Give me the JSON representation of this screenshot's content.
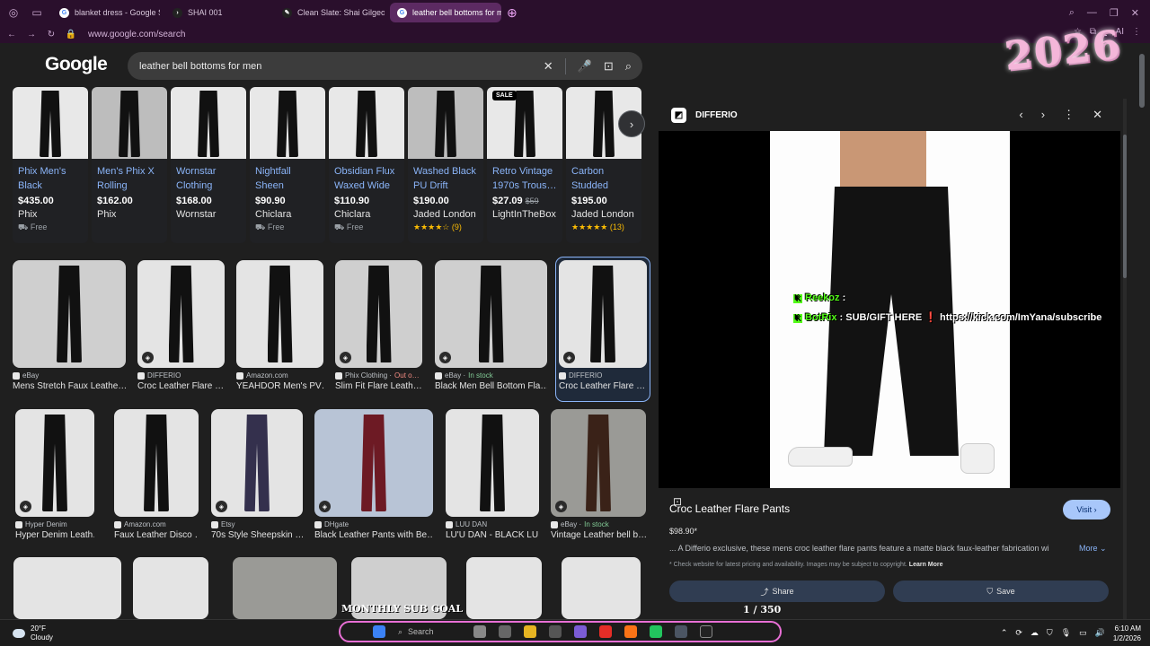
{
  "browser": {
    "tabs": [
      {
        "label": "blanket dress - Google Se",
        "active": false
      },
      {
        "label": "SHAI 001",
        "active": false
      },
      {
        "label": "Clean Slate: Shai Gilgeous",
        "active": false
      },
      {
        "label": "leather bell bottoms for me",
        "active": true
      }
    ],
    "url": "www.google.com/search"
  },
  "google": {
    "logo": "Google",
    "query": "leather bell bottoms for men"
  },
  "overlay_year": "2026",
  "shopping": [
    {
      "title": "Phix Men's Black Leathe…",
      "price": "$435.00",
      "old_price": "",
      "seller": "Phix",
      "extra": "Free",
      "sale": false
    },
    {
      "title": "Men's Phix X Rolling Stone…",
      "price": "$162.00",
      "old_price": "",
      "seller": "Phix",
      "extra": "",
      "sale": false
    },
    {
      "title": "Wornstar Clothing Cutl…",
      "price": "$168.00",
      "old_price": "",
      "seller": "Wornstar",
      "extra": "",
      "sale": false
    },
    {
      "title": "Nightfall Sheen Flared…",
      "price": "$90.90",
      "old_price": "",
      "seller": "Chiclara",
      "extra": "Free",
      "sale": false
    },
    {
      "title": "Obsidian Flux Waxed Wide …",
      "price": "$110.90",
      "old_price": "",
      "seller": "Chiclara",
      "extra": "Free",
      "sale": false
    },
    {
      "title": "Washed Black PU Drift Jean…",
      "price": "$190.00",
      "old_price": "",
      "seller": "Jaded London",
      "extra": "★★★★☆ (9)",
      "sale": false
    },
    {
      "title": "Retro Vintage 1970s Trous…",
      "price": "$27.09",
      "old_price": "$59",
      "seller": "LightInTheBox",
      "extra": "",
      "sale": true
    },
    {
      "title": "Carbon Studded Drift…",
      "price": "$195.00",
      "old_price": "",
      "seller": "Jaded London",
      "extra": "★★★★★ (13)",
      "sale": false
    }
  ],
  "sale_label": "SALE",
  "images_row1": [
    {
      "source": "eBay",
      "stock": "",
      "title": "Mens Stretch Faux Leathe…"
    },
    {
      "source": "DIFFERIO",
      "stock": "",
      "title": "Croc Leather Flare …"
    },
    {
      "source": "Amazon.com",
      "stock": "",
      "title": "YEAHDOR Men's PV…"
    },
    {
      "source": "Phix Clothing · ",
      "stock": "Out o…",
      "title": "Slim Fit Flare Leath…"
    },
    {
      "source": "eBay · ",
      "stock": "In stock",
      "title": "Black Men Bell Bottom Fla…"
    },
    {
      "source": "DIFFERIO",
      "stock": "",
      "title": "Croc Leather Flare …"
    }
  ],
  "images_row2": [
    {
      "source": "Hyper Denim",
      "stock": "",
      "title": "Hyper Denim Leath…"
    },
    {
      "source": "Amazon.com",
      "stock": "",
      "title": "Faux Leather Disco …"
    },
    {
      "source": "Etsy",
      "stock": "",
      "title": "70s Style Sheepskin …"
    },
    {
      "source": "DHgate",
      "stock": "",
      "title": "Black Leather Pants with Be…"
    },
    {
      "source": "LUU DAN",
      "stock": "",
      "title": "LU'U DAN - BLACK LU…"
    },
    {
      "source": "eBay · ",
      "stock": "In stock",
      "title": "Vintage Leather bell b…"
    }
  ],
  "panel": {
    "site": "DIFFERIO",
    "title": "Croc Leather Flare Pants",
    "visit": "Visit",
    "price": "$98.90*",
    "description": "... A Differio exclusive, these mens croc leather flare pants feature a matte black faux-leather fabrication wit…",
    "more": "More",
    "note": "* Check website for latest pricing and availability. Images may be subject to copyright.",
    "learn_more": "Learn More",
    "share": "Share",
    "save": "Save",
    "counter": "1 / 350"
  },
  "chat": {
    "line1_name": "Reekoz",
    "line1_text": ":",
    "line2_name": "BotRix",
    "line2_text": ": SUB/GIFT HERE ❗ https://kick.com/ImYana/subscribe"
  },
  "taskbar": {
    "temp": "20°F",
    "condition": "Cloudy",
    "search": "Search",
    "sub_goal": "MONTHLY SUB GOAL",
    "time": "6:10 AM",
    "date": "1/2/2026"
  }
}
